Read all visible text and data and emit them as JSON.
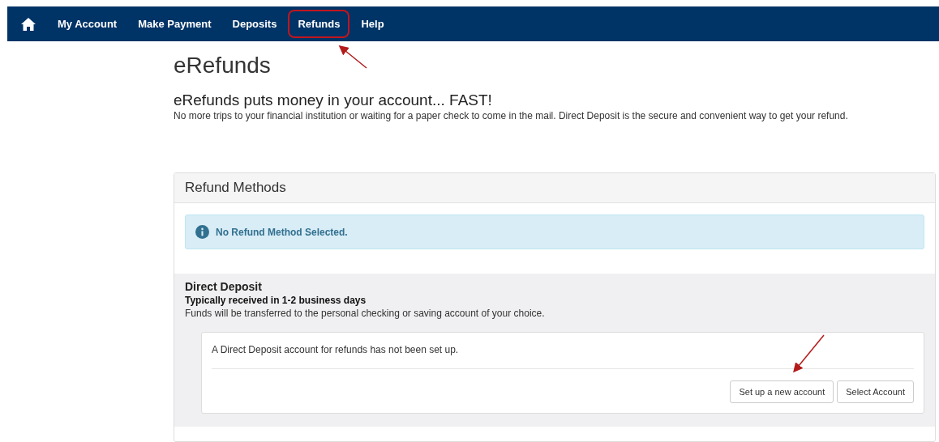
{
  "nav": {
    "items": [
      {
        "label": "My Account",
        "annotated": false
      },
      {
        "label": "Make Payment",
        "annotated": false
      },
      {
        "label": "Deposits",
        "annotated": false
      },
      {
        "label": "Refunds",
        "annotated": true
      },
      {
        "label": "Help",
        "annotated": false
      }
    ]
  },
  "page": {
    "title": "eRefunds",
    "headline": "eRefunds puts money in your account... FAST!",
    "intro": "No more trips to your financial institution or waiting for a paper check to come in the mail. Direct Deposit is the secure and convenient way to get your refund."
  },
  "panel": {
    "title": "Refund Methods",
    "alert": "No Refund Method Selected.",
    "method": {
      "title": "Direct Deposit",
      "subtitle": "Typically received in 1-2 business days",
      "description": "Funds will be transferred to the personal checking or saving account of your choice.",
      "card": {
        "message": "A Direct Deposit account for refunds has not been set up.",
        "buttons": [
          {
            "label": "Set up a new account"
          },
          {
            "label": "Select Account"
          }
        ]
      }
    }
  }
}
